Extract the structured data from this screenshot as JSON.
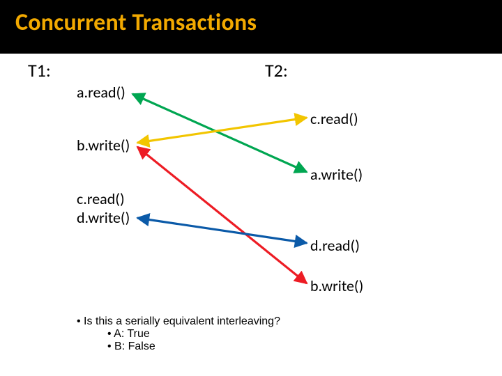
{
  "title": "Concurrent Transactions",
  "headers": {
    "t1": "T1:",
    "t2": "T2:"
  },
  "t1": {
    "op1": "a.read()",
    "op2": "b.write()",
    "op3": "c.read()",
    "op4": "d.write()"
  },
  "t2": {
    "op1": "c.read()",
    "op2": "a.write()",
    "op3": "d.read()",
    "op4": "b.write()"
  },
  "question": {
    "prompt": "Is this a serially equivalent interleaving?",
    "optA": "A: True",
    "optB": "B: False"
  },
  "colors": {
    "green": "#00a651",
    "red": "#ed1c24",
    "yellow": "#f2c500",
    "blue": "#0b5aa8"
  }
}
